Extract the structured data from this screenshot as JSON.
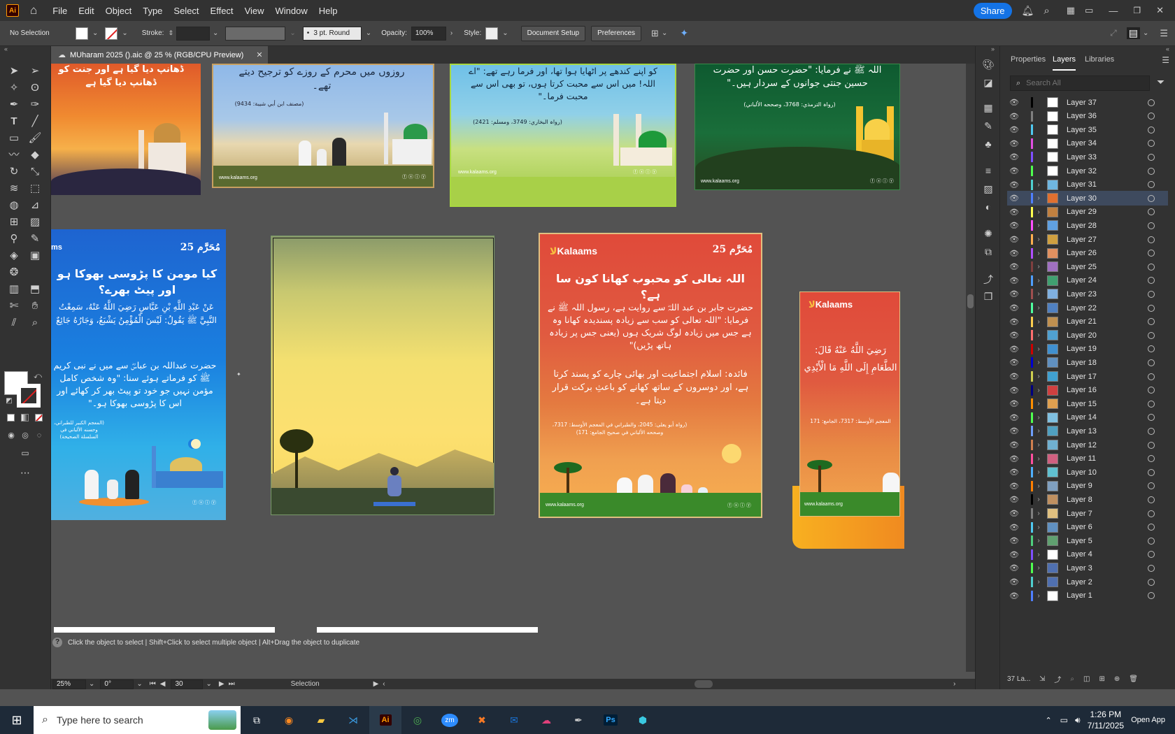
{
  "app": {
    "logo": "Ai",
    "menu": [
      "File",
      "Edit",
      "Object",
      "Type",
      "Select",
      "Effect",
      "View",
      "Window",
      "Help"
    ],
    "share_label": "Share"
  },
  "control": {
    "selection": "No Selection",
    "stroke_label": "Stroke:",
    "brush": "3 pt. Round",
    "opacity_label": "Opacity:",
    "opacity_value": "100%",
    "style_label": "Style:",
    "doc_setup": "Document Setup",
    "preferences": "Preferences"
  },
  "document": {
    "tab_title": "MUharam 2025 ().aic @ 25 % (RGB/CPU Preview)"
  },
  "artboards": {
    "a1": {
      "text": "ڈھانپ دیا گیا ہے اور جنت کو ڈھانپ دیا گیا ہے"
    },
    "a2": {
      "text": "روزوں میں محرم کے روزے کو ترجیح دیتے تھے۔",
      "ref": "(مصنف ابن أبي شيبة: 9434)",
      "url": "www.kalaams.org"
    },
    "a3": {
      "text": "کو اپنے کندھے پر اٹھایا ہوا تھا، اور فرما رہے تھے: \"اے اللہ! میں اس سے محبت کرتا ہوں، تو بھی اس سے محبت فرما۔\"",
      "ref": "(رواہ البخاري: 3749، ومسلم: 2421)",
      "url": "www.kalaams.org"
    },
    "a4": {
      "text": "اللہ ﷺ نے فرمایا: \"حضرت حسن اور حضرت حسین جنتی جوانوں کے سردار ہیں۔\"",
      "ref": "(رواہ الترمذي: 3768، وصححه الألباني)",
      "url": "www.kalaams.org"
    },
    "a5": {
      "badge": "مُحَرَّم 25",
      "title": "کیا مومن کا پڑوسی بھوکا ہو اور پیٹ بھرے؟",
      "arabic": "عَنْ عَبْدِ اللَّهِ بْنِ عَبَّاسٍ رَضِيَ اللَّهُ عَنْهُ، سَمِعْتُ النَّبِيَّ ﷺ يَقُولُ: لَيْسَ الْمُؤْمِنُ يَشْبَعُ، وَجَارُهُ جَائِعٌ",
      "urdu": "حضرت عبداللہ بن عباسؓ سے میں نے نبی کریم ﷺ کو فرماتے ہوئے سنا: \"وہ شخص کامل مؤمن نہیں جو خود تو پیٹ بھر کر کھائے اور اس کا پڑوسی بھوکا ہو۔\"",
      "ref": "(المعجم الكبير للطبراني، وحسنه الألباني في السلسلة الصحيحة)"
    },
    "a7": {
      "logo": "Kalaams",
      "badge": "مُحَرَّم 25",
      "title": "اللہ تعالی کو محبوب کھانا کون سا ہے؟",
      "body": "حضرت جابر بن عبد اللہؓ سے روایت ہے، رسول اللہ ﷺ نے فرمایا: \"اللہ تعالی کو سب سے زیادہ پسندیدہ کھانا وہ ہے جس میں زیادہ لوگ شریک ہوں (یعنی جس پر زیادہ ہاتھ پڑیں)\"",
      "fayda": "فائدہ: اسلام اجتماعیت اور بھائی چارے کو پسند کرتا ہے، اور دوسروں کے ساتھ کھانے کو باعثِ برکت قرار دیتا ہے۔",
      "ref": "(رواہ أبو يعلى: 2045، والطبراني في المعجم الأوسط: 7317، وصححه الألباني في صحيح الجامع: 171)",
      "url": "www.kalaams.org"
    },
    "a8": {
      "logo": "Kalaams",
      "arabic": "رَضِيَ اللَّهُ عَنْهُ قَالَ: الطَّعَامِ إِلَى اللَّهِ مَا الْأَيْدِي",
      "ref": "المعجم الأوسط: 7317، الجامع: 171",
      "url": "www.kalaams.org"
    }
  },
  "status": {
    "hint": "Click the object to select  |  Shift+Click to select multiple object  |  Alt+Drag the object to duplicate",
    "zoom": "25%",
    "rotate": "0°",
    "artboard": "30",
    "tool": "Selection"
  },
  "panel": {
    "tabs": [
      "Properties",
      "Layers",
      "Libraries"
    ],
    "search_placeholder": "Search All",
    "layer_count": "37 La...",
    "selected_layer": "Layer 30",
    "layers": [
      {
        "name": "Layer 37",
        "color": "#000000",
        "expand": false,
        "thumb": "#ffffff"
      },
      {
        "name": "Layer 36",
        "color": "#7f7f7f",
        "expand": false,
        "thumb": "#ffffff"
      },
      {
        "name": "Layer 35",
        "color": "#4fc9f0",
        "expand": false,
        "thumb": "#ffffff"
      },
      {
        "name": "Layer 34",
        "color": "#e04fe0",
        "expand": false,
        "thumb": "#ffffff"
      },
      {
        "name": "Layer 33",
        "color": "#7f4fff",
        "expand": false,
        "thumb": "#ffffff"
      },
      {
        "name": "Layer 32",
        "color": "#4fff4f",
        "expand": false,
        "thumb": "#ffffff"
      },
      {
        "name": "Layer 31",
        "color": "#4fcfcf",
        "expand": true,
        "thumb": "#6fb6e0"
      },
      {
        "name": "Layer 30",
        "color": "#4f7fff",
        "expand": true,
        "thumb": "#e07030"
      },
      {
        "name": "Layer 29",
        "color": "#ffff4f",
        "expand": true,
        "thumb": "#c08040"
      },
      {
        "name": "Layer 28",
        "color": "#ff4fff",
        "expand": true,
        "thumb": "#60a0e0"
      },
      {
        "name": "Layer 27",
        "color": "#ffb04f",
        "expand": true,
        "thumb": "#d0a040"
      },
      {
        "name": "Layer 26",
        "color": "#b04fff",
        "expand": true,
        "thumb": "#e09060"
      },
      {
        "name": "Layer 25",
        "color": "#7f3f3f",
        "expand": true,
        "thumb": "#a070c0"
      },
      {
        "name": "Layer 24",
        "color": "#4f9fff",
        "expand": true,
        "thumb": "#40a070"
      },
      {
        "name": "Layer 23",
        "color": "#9f4f4f",
        "expand": true,
        "thumb": "#80b0e0"
      },
      {
        "name": "Layer 22",
        "color": "#4fff9f",
        "expand": true,
        "thumb": "#5080c0"
      },
      {
        "name": "Layer 21",
        "color": "#ffcf4f",
        "expand": true,
        "thumb": "#c09050"
      },
      {
        "name": "Layer 20",
        "color": "#ff6f6f",
        "expand": true,
        "thumb": "#50a0d0"
      },
      {
        "name": "Layer 19",
        "color": "#cf0000",
        "expand": true,
        "thumb": "#4090d0"
      },
      {
        "name": "Layer 18",
        "color": "#0000cf",
        "expand": true,
        "thumb": "#6090c0"
      },
      {
        "name": "Layer 17",
        "color": "#cfcf4f",
        "expand": true,
        "thumb": "#40a0d0"
      },
      {
        "name": "Layer 16",
        "color": "#000080",
        "expand": true,
        "thumb": "#d04040"
      },
      {
        "name": "Layer 15",
        "color": "#ff8f00",
        "expand": true,
        "thumb": "#e0a050"
      },
      {
        "name": "Layer 14",
        "color": "#4fff4f",
        "expand": true,
        "thumb": "#80c0e0"
      },
      {
        "name": "Layer 13",
        "color": "#6fa0ff",
        "expand": true,
        "thumb": "#50a0c0"
      },
      {
        "name": "Layer 12",
        "color": "#d07f4f",
        "expand": true,
        "thumb": "#70b0d0"
      },
      {
        "name": "Layer 11",
        "color": "#ff4f9f",
        "expand": true,
        "thumb": "#d06080"
      },
      {
        "name": "Layer 10",
        "color": "#4fb0ff",
        "expand": true,
        "thumb": "#60c0d0"
      },
      {
        "name": "Layer 9",
        "color": "#ff7f00",
        "expand": true,
        "thumb": "#80a0c0"
      },
      {
        "name": "Layer 8",
        "color": "#000000",
        "expand": true,
        "thumb": "#c09060"
      },
      {
        "name": "Layer 7",
        "color": "#7f7f7f",
        "expand": true,
        "thumb": "#e0c080"
      },
      {
        "name": "Layer 6",
        "color": "#4fc9f0",
        "expand": true,
        "thumb": "#6090c0"
      },
      {
        "name": "Layer 5",
        "color": "#4fcf7f",
        "expand": true,
        "thumb": "#60a070"
      },
      {
        "name": "Layer 4",
        "color": "#7f4fff",
        "expand": true,
        "thumb": "#ffffff"
      },
      {
        "name": "Layer 3",
        "color": "#4fff4f",
        "expand": true,
        "thumb": "#5070b0"
      },
      {
        "name": "Layer 2",
        "color": "#4fcfcf",
        "expand": true,
        "thumb": "#5070b0"
      },
      {
        "name": "Layer 1",
        "color": "#4f7fff",
        "expand": true,
        "thumb": "#ffffff"
      }
    ]
  },
  "taskbar": {
    "search_placeholder": "Type here to search",
    "time": "1:26 PM",
    "date": "7/11/2025",
    "overflow": "Open App"
  }
}
